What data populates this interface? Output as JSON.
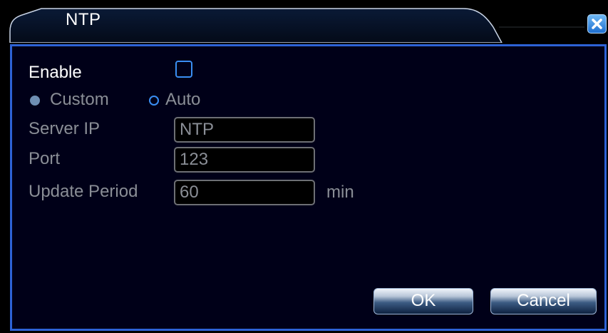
{
  "window": {
    "title": "NTP",
    "close_icon": "close-icon"
  },
  "form": {
    "enable": {
      "label": "Enable",
      "checked": false
    },
    "mode": {
      "options": [
        {
          "label": "Custom",
          "selected": true
        },
        {
          "label": "Auto",
          "selected": false
        }
      ]
    },
    "server_ip": {
      "label": "Server IP",
      "value": "NTP"
    },
    "port": {
      "label": "Port",
      "value": "123"
    },
    "update_period": {
      "label": "Update Period",
      "value": "60",
      "unit": "min"
    }
  },
  "buttons": {
    "ok_label": "OK",
    "cancel_label": "Cancel"
  },
  "colors": {
    "accent": "#2d62d6",
    "control_outline": "#3a8ef2",
    "disabled_text": "#8a8e96",
    "background": "#000000"
  }
}
